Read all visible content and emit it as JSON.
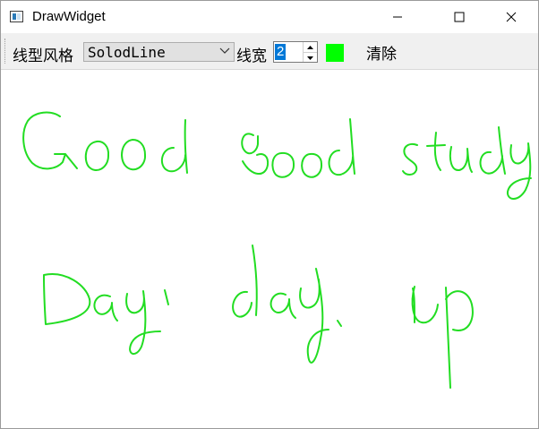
{
  "window": {
    "title": "DrawWidget"
  },
  "toolbar": {
    "line_style_label": "线型风格",
    "line_style_selected": "SolodLine",
    "line_width_label": "线宽",
    "line_width_value": "2",
    "pen_color": "#00ff00",
    "clear_label": "清除"
  },
  "canvas": {
    "stroke_color": "#22dd22",
    "handwriting_lines": [
      "Good good study",
      "Day day up"
    ]
  },
  "icons": [
    "app-window-icon",
    "minimize-icon",
    "maximize-icon",
    "close-icon",
    "chevron-down-icon",
    "spin-up-icon",
    "spin-down-icon"
  ]
}
